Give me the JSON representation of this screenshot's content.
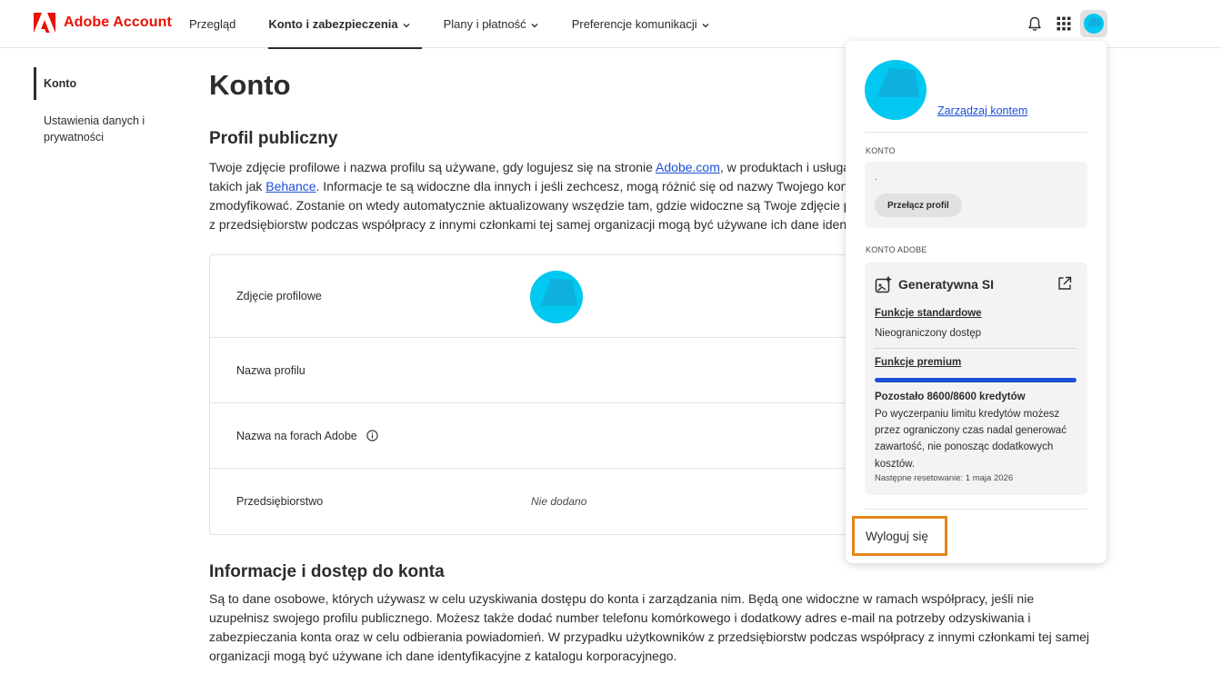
{
  "header": {
    "brand": "Adobe Account",
    "nav": [
      {
        "label": "Przegląd",
        "active": false,
        "has_menu": false
      },
      {
        "label": "Konto i zabezpieczenia",
        "active": true,
        "has_menu": true
      },
      {
        "label": "Plany i płatność",
        "active": false,
        "has_menu": true
      },
      {
        "label": "Preferencje komunikacji",
        "active": false,
        "has_menu": true
      }
    ],
    "icons": [
      "bell-icon",
      "apps-grid-icon",
      "avatar"
    ]
  },
  "sidebar": {
    "items": [
      {
        "label": "Konto",
        "active": true
      },
      {
        "label": "Ustawienia danych i prywatności",
        "active": false
      }
    ]
  },
  "main": {
    "title": "Konto",
    "profile": {
      "title": "Profil publiczny",
      "para_line1_a": "Twoje zdjęcie profilowe i nazwa profilu są używane, gdy logujesz się na stronie ",
      "para_link1": "Adobe.com",
      "para_line1_b": ", w produktach i usługach Adob",
      "para_line2_a": "takich jak ",
      "para_link2": "Behance",
      "para_line2_b": ". Informacje te są widoczne dla innych i jeśli zechcesz, mogą różnić się od nazwy Twojego konta. Profil",
      "para_line3": "zmodyfikować. Zostanie on wtedy automatycznie aktualizowany wszędzie tam, gdzie widoczne są Twoje zdjęcie profilow",
      "para_line4": "z przedsiębiorstw podczas współpracy z innymi członkami tej samej organizacji mogą być używane ich dane identyfikacy",
      "rows": [
        {
          "label": "Zdjęcie profilowe",
          "value": ""
        },
        {
          "label": "Nazwa profilu",
          "value": ""
        },
        {
          "label": "Nazwa na forach Adobe",
          "value": ""
        },
        {
          "label": "Przedsiębiorstwo",
          "value": "Nie dodano"
        }
      ]
    },
    "access": {
      "title": "Informacje i dostęp do konta",
      "para": "Są to dane osobowe, których używasz w celu uzyskiwania dostępu do konta i zarządzania nim. Będą one widoczne w ramach współpracy, jeśli nie uzupełnisz swojego profilu publicznego. Możesz także dodać number telefonu komórkowego i dodatkowy adres e-mail na potrzeby odzyskiwania i zabezpieczania konta oraz w celu odbierania powiadomień. W przypadku użytkowników z przedsiębiorstw podczas współpracy z innymi członkami tej samej organizacji mogą być używane ich dane identyfikacyjne z katalogu korporacyjnego."
    }
  },
  "panel": {
    "manage_link": "Zarządzaj kontem",
    "account_label": "KONTO",
    "account_dot": ".",
    "switch_profile": "Przełącz profil",
    "adobe_account_label": "KONTO ADOBE",
    "genai": {
      "title": "Generatywna SI",
      "standard_link": "Funkcje standardowe",
      "standard_text": "Nieograniczony dostęp",
      "premium_link": "Funkcje premium",
      "credits_remaining": 8600,
      "credits_total": 8600,
      "credits_title": "Pozostało 8600/8600 kredytów",
      "credits_desc": "Po wyczerpaniu limitu kredytów możesz przez ograniczony czas nadal generować zawartość, nie ponosząc dodatkowych kosztów.",
      "reset_text": "Następne resetowanie: 1 maja 2026"
    },
    "logout": "Wyloguj się"
  },
  "colors": {
    "brand_red": "#eb1000",
    "link_blue": "#1d4ed8",
    "avatar_cyan": "#00c8f0",
    "highlight_orange": "#e68619"
  }
}
